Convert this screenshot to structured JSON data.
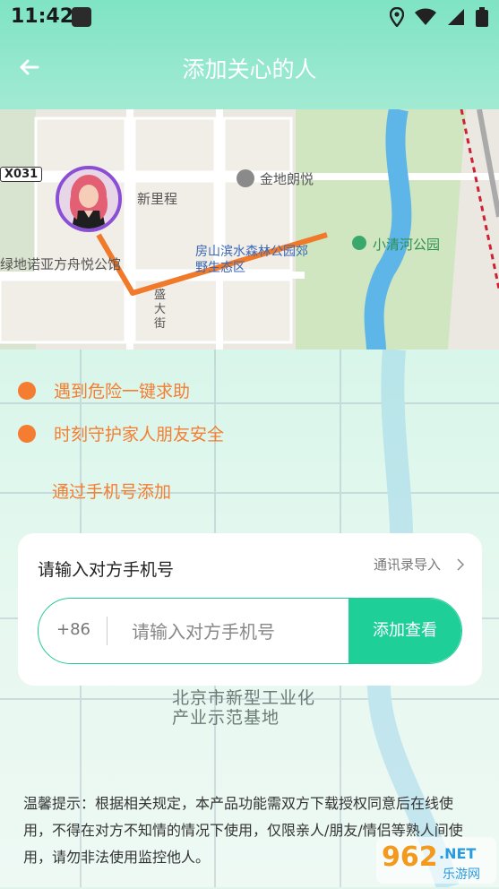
{
  "status_bar": {
    "time": "11:42"
  },
  "header": {
    "back_icon": "arrow-left-icon",
    "title": "添加关心的人"
  },
  "map": {
    "labels": {
      "road_tag": "X031",
      "xinlicheng": "新里程",
      "jindi": "金地朗悦",
      "fangshan_park": "房山滨水森林公园郊野生态区",
      "xiaoqinghe": "小清河公园",
      "nuoya": "绿地诺亚方舟悦公馆",
      "street": "盛大街"
    }
  },
  "features": [
    {
      "text": "遇到危险一键求助"
    },
    {
      "text": "时刻守护家人朋友安全"
    }
  ],
  "section_label": "通过手机号添加",
  "card": {
    "title": "请输入对方手机号",
    "contacts_import": "通讯录导入",
    "country_code": "+86",
    "phone_placeholder": "请输入对方手机号",
    "add_button": "添加查看"
  },
  "background_map_label": "北京市新型工业化产业示范基地",
  "notice": "温馨提示：根据相关规定，本产品功能需双方下载授权同意后在线使用，不得在对方不知情的情况下使用，仅限亲人/朋友/情侣等熟人间使用，请勿非法使用监控他人。",
  "watermark": {
    "text1": "962",
    "text2": ".NET",
    "text3": "乐游网"
  },
  "colors": {
    "accent": "#1fcf98",
    "orange": "#f47d32",
    "route": "#f07a2a"
  }
}
